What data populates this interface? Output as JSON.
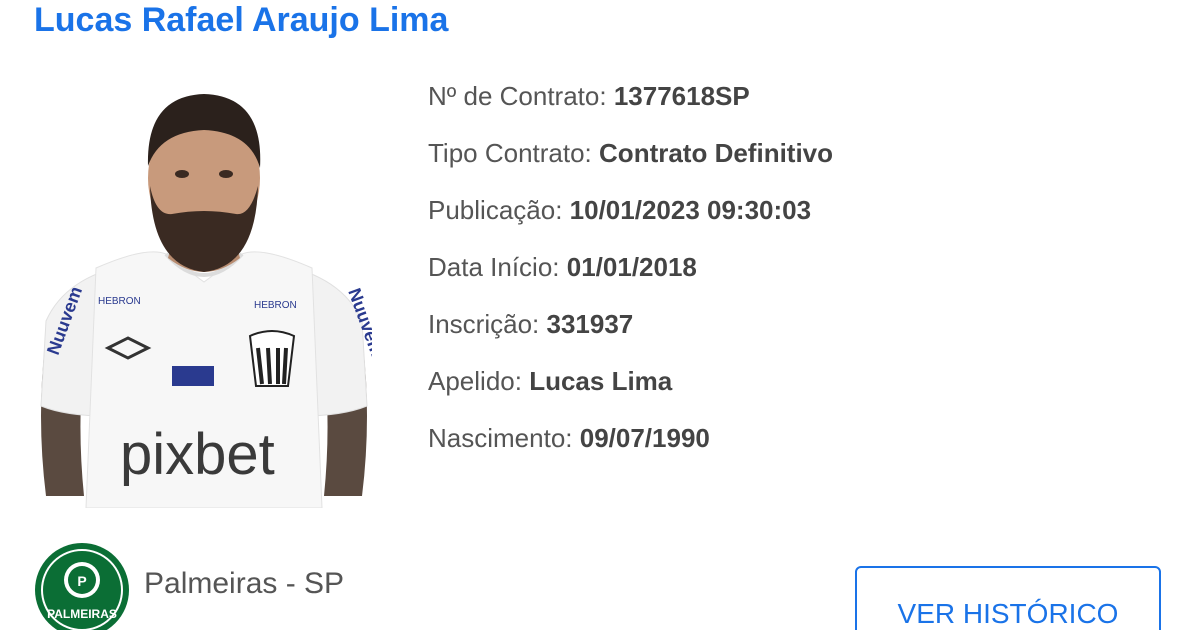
{
  "player": {
    "full_name": "Lucas Rafael Araujo Lima"
  },
  "details": [
    {
      "label": "Nº de Contrato:",
      "value": "1377618SP"
    },
    {
      "label": "Tipo Contrato:",
      "value": "Contrato Definitivo"
    },
    {
      "label": "Publicação:",
      "value": "10/01/2023 09:30:03"
    },
    {
      "label": "Data Início:",
      "value": "01/01/2018"
    },
    {
      "label": "Inscrição:",
      "value": "331937"
    },
    {
      "label": "Apelido:",
      "value": "Lucas Lima"
    },
    {
      "label": "Nascimento:",
      "value": "09/07/1990"
    }
  ],
  "club": {
    "name": "Palmeiras - SP",
    "logo_icon": "palmeiras-crest-icon",
    "logo_text": "PALMEIRAS",
    "logo_color": "#0b6e35"
  },
  "photo": {
    "icon": "player-photo",
    "shirt_sponsor": "pixbet"
  },
  "actions": {
    "history_label": "VER HISTÓRICO"
  },
  "colors": {
    "accent": "#1a73e8",
    "text": "#555555"
  }
}
